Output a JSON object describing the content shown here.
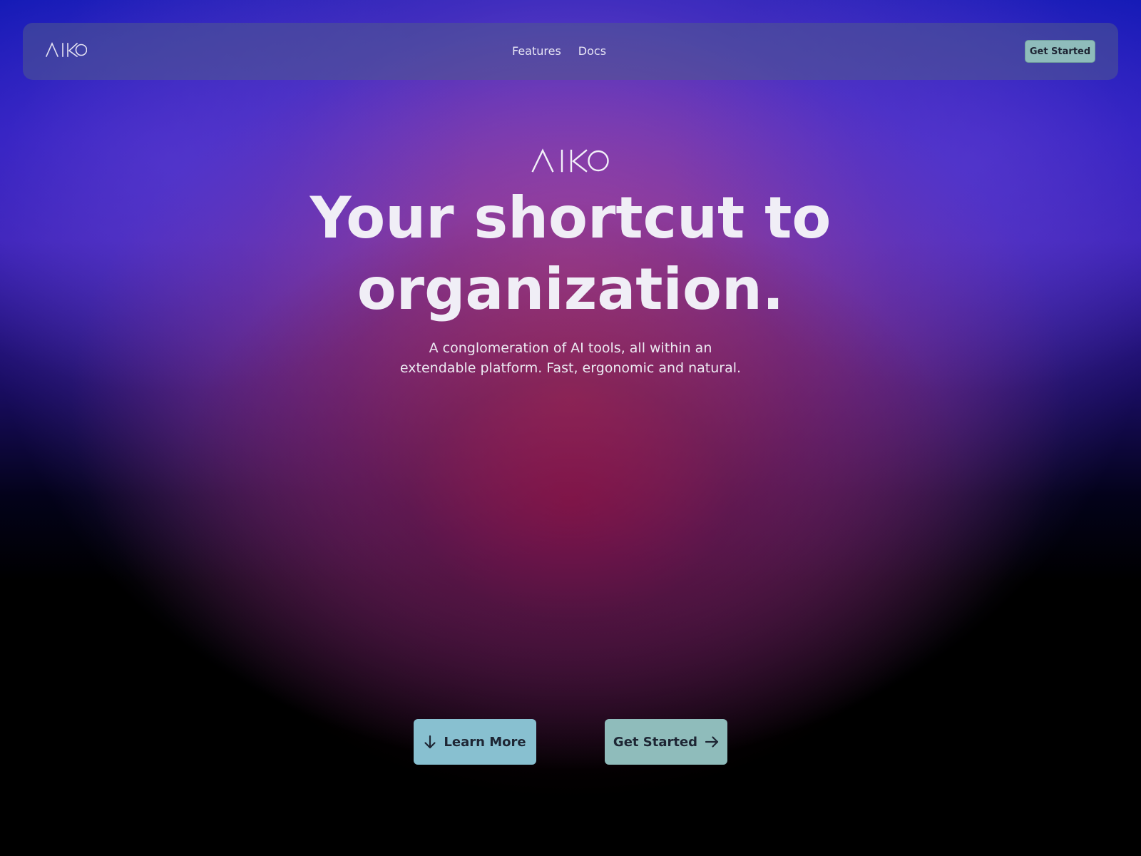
{
  "brand": {
    "name": "AIKO"
  },
  "navbar": {
    "links": [
      {
        "label": "Features"
      },
      {
        "label": "Docs"
      }
    ],
    "cta_label": "Get Started"
  },
  "hero": {
    "title_line1": "Your shortcut to",
    "title_line2": "organization.",
    "subtitle_line1": "A conglomeration of AI tools, all within an",
    "subtitle_line2": "extendable platform. Fast, ergonomic and natural.",
    "buttons": {
      "learn_more": {
        "label": "Learn More",
        "icon": "arrow-down-icon"
      },
      "get_started": {
        "label": "Get Started",
        "icon": "arrow-right-icon"
      }
    }
  },
  "colors": {
    "accent_learn": "#88c0d0",
    "accent_start": "#8fbcbb",
    "text_dark": "#1e2634",
    "text_light": "#f0eef6"
  }
}
